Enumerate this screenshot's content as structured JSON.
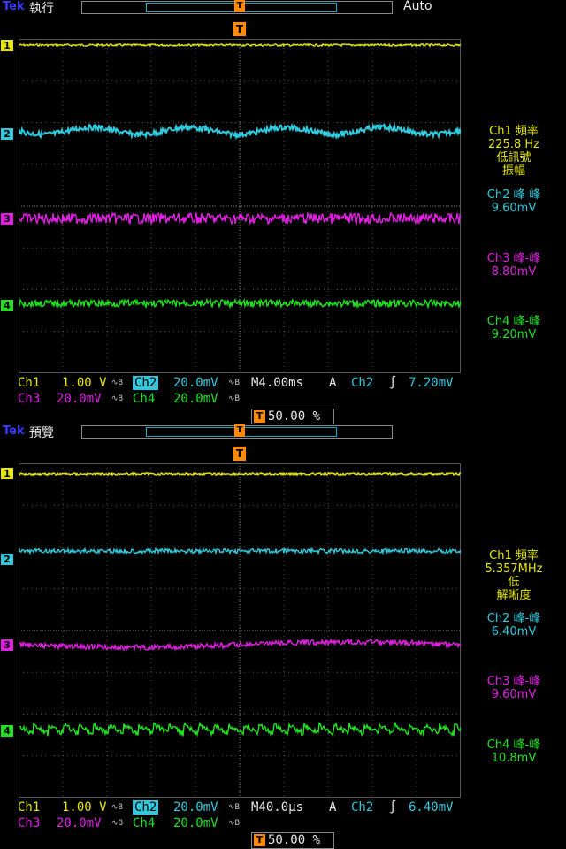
{
  "panels": [
    {
      "brand": "Tek",
      "mode": "執行",
      "trigger_mode": "Auto",
      "measurements": [
        {
          "source": "Ch1 頻率",
          "value": "225.8 Hz",
          "note1": "低訊號",
          "note2": "振幅"
        },
        {
          "source": "Ch2 峰-峰",
          "value": "9.60mV"
        },
        {
          "source": "Ch3 峰-峰",
          "value": "8.80mV"
        },
        {
          "source": "Ch4 峰-峰",
          "value": "9.20mV"
        }
      ],
      "status": {
        "ch1_label": "Ch1",
        "ch1_scale": "1.00 V",
        "ch2_label": "Ch2",
        "ch2_scale": "20.0mV",
        "ch3_label": "Ch3",
        "ch3_scale": "20.0mV",
        "ch4_label": "Ch4",
        "ch4_scale": "20.0mV",
        "timebase": "M4.00ms",
        "coupling": "A",
        "trig_source": "Ch2",
        "trig_slope": "∫",
        "trig_level": "7.20mV",
        "trig_pos": "50.00 %"
      }
    },
    {
      "brand": "Tek",
      "mode": "預覽",
      "trigger_mode": "",
      "measurements": [
        {
          "source": "Ch1 頻率",
          "value": "5.357MHz",
          "note1": "低",
          "note2": "解晰度"
        },
        {
          "source": "Ch2 峰-峰",
          "value": "6.40mV"
        },
        {
          "source": "Ch3 峰-峰",
          "value": "9.60mV"
        },
        {
          "source": "Ch4 峰-峰",
          "value": "10.8mV"
        }
      ],
      "status": {
        "ch1_label": "Ch1",
        "ch1_scale": "1.00 V",
        "ch2_label": "Ch2",
        "ch2_scale": "20.0mV",
        "ch3_label": "Ch3",
        "ch3_scale": "20.0mV",
        "ch4_label": "Ch4",
        "ch4_scale": "20.0mV",
        "timebase": "M40.0µs",
        "coupling": "A",
        "trig_source": "Ch2",
        "trig_slope": "∫",
        "trig_level": "6.40mV",
        "trig_pos": "50.00 %"
      }
    }
  ],
  "channel_markers": [
    "1",
    "2",
    "3",
    "4"
  ],
  "trigger_icon": "T",
  "colors": {
    "ch1": "#e6e600",
    "ch2": "#2ec9dc",
    "ch3": "#e020e0",
    "ch4": "#20e020",
    "trigger": "#ff8a00"
  }
}
